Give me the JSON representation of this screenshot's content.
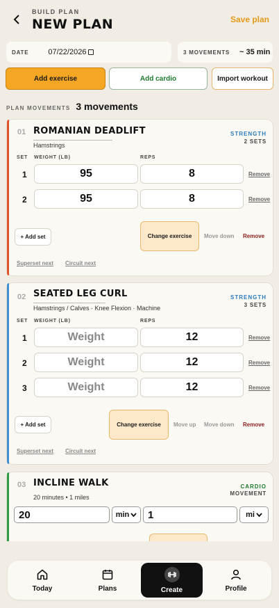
{
  "header": {
    "eyebrow": "BUILD PLAN",
    "title": "NEW PLAN",
    "save_label": "Save plan"
  },
  "info": {
    "date_label": "DATE",
    "date_value": "07/22/2026",
    "movements_label": "3 MOVEMENTS",
    "duration": "~ 35 min"
  },
  "actions": {
    "add_exercise": "Add exercise",
    "add_cardio": "Add cardio",
    "import_workout": "Import workout"
  },
  "plan": {
    "label": "PLAN MOVEMENTS",
    "count": "3 movements"
  },
  "cols": {
    "set": "SET",
    "weight": "WEIGHT (LB)",
    "reps": "REPS"
  },
  "controls": {
    "add_set": "+ Add set",
    "change_exercise": "Change exercise",
    "move_up": "Move up",
    "move_down": "Move down",
    "remove": "Remove",
    "remove_set": "Remove",
    "superset": "Superset next",
    "circuit": "Circuit next",
    "weight_placeholder": "Weight"
  },
  "exercises": [
    {
      "num": "01",
      "name": "ROMANIAN DEADLIFT",
      "sub": "Hamstrings",
      "type": "STRENGTH",
      "sets_label": "2 SETS",
      "sets": [
        {
          "set": "1",
          "weight": "95",
          "reps": "8"
        },
        {
          "set": "2",
          "weight": "95",
          "reps": "8"
        }
      ]
    },
    {
      "num": "02",
      "name": "SEATED LEG CURL",
      "sub": "Hamstrings / Calves · Knee Flexion · Machine",
      "type": "STRENGTH",
      "sets_label": "3 SETS",
      "sets": [
        {
          "set": "1",
          "weight": "",
          "reps": "12"
        },
        {
          "set": "2",
          "weight": "",
          "reps": "12"
        },
        {
          "set": "3",
          "weight": "",
          "reps": "12"
        }
      ]
    },
    {
      "num": "03",
      "name": "INCLINE WALK",
      "sub": "20 minutes • 1 miles",
      "type": "CARDIO",
      "sets_label": "MOVEMENT",
      "duration_value": "20",
      "duration_unit": "min",
      "distance_value": "1",
      "distance_unit": "mi"
    }
  ],
  "tabs": [
    {
      "label": "Today"
    },
    {
      "label": "Plans"
    },
    {
      "label": "Create"
    },
    {
      "label": "Profile"
    }
  ],
  "colors": {
    "accent": "#f5a623",
    "strength": "#2b7bbf",
    "cardio": "#1f7a2e",
    "card1_bar": "#e0532a",
    "card2_bar": "#3f8fd2",
    "card3_bar": "#2e9a44"
  }
}
